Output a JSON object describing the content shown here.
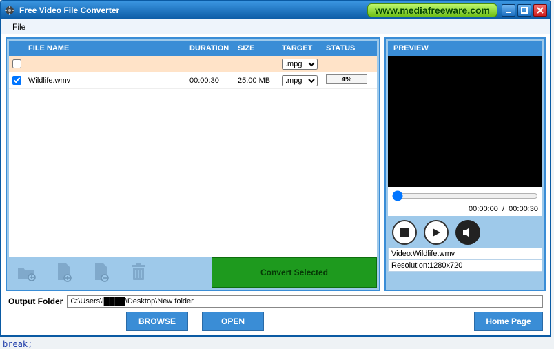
{
  "window": {
    "title": "Free Video File Converter",
    "site_url": "www.mediafreeware.com"
  },
  "menu": {
    "file": "File"
  },
  "table": {
    "headers": {
      "name": "FILE NAME",
      "duration": "DURATION",
      "size": "SIZE",
      "target": "TARGET",
      "status": "STATUS"
    },
    "template_target": ".mpg",
    "rows": [
      {
        "checked": true,
        "name": "Wildlife.wmv",
        "duration": "00:00:30",
        "size": "25.00 MB",
        "target": ".mpg",
        "progress_pct": 4,
        "progress_label": "4%"
      }
    ]
  },
  "toolbar": {
    "convert": "Convert Selected"
  },
  "preview": {
    "header": "PREVIEW",
    "time_current": "00:00:00",
    "time_sep": "/",
    "time_total": "00:00:30",
    "video_label": "Video:Wildlife.wmv",
    "resolution_label": "Resolution:1280x720"
  },
  "output": {
    "label": "Output Folder",
    "path": "C:\\Users\\i████\\Desktop\\New folder",
    "browse": "BROWSE",
    "open": "OPEN"
  },
  "footer": {
    "home": "Home Page"
  },
  "stray": {
    "code": "break;"
  }
}
